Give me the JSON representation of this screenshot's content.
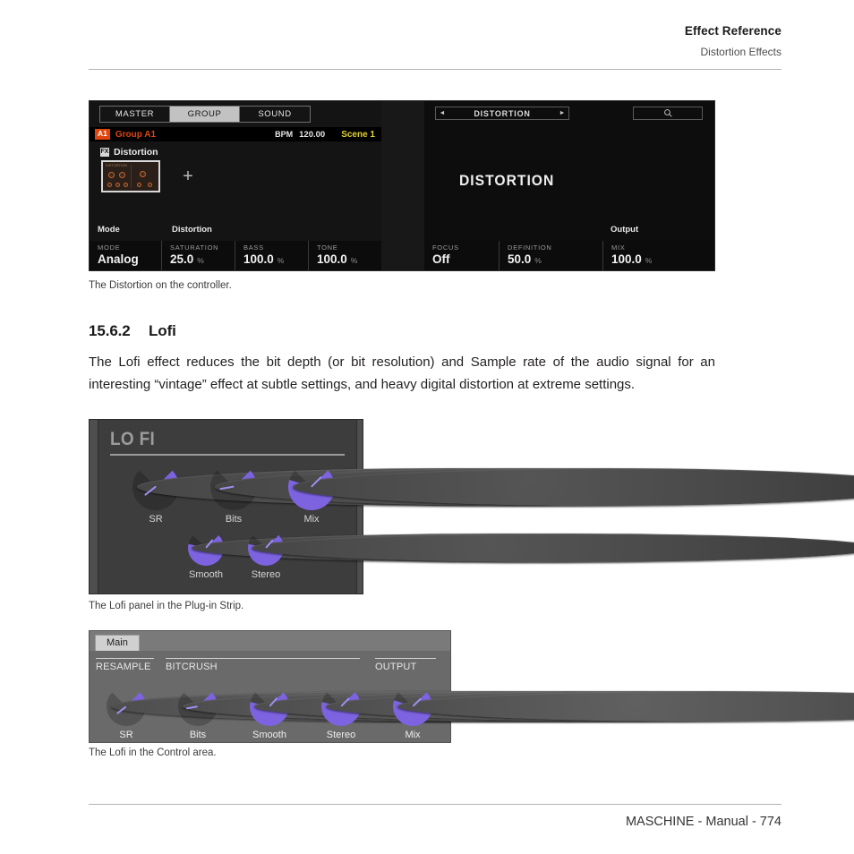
{
  "runhead": {
    "title": "Effect Reference",
    "subtitle": "Distortion Effects"
  },
  "controller_figure": {
    "tabs": [
      {
        "label": "MASTER",
        "selected": false
      },
      {
        "label": "GROUP",
        "selected": true
      },
      {
        "label": "SOUND",
        "selected": false
      }
    ],
    "group_bar": {
      "badge": "A1",
      "name": "Group A1",
      "bpm_label": "BPM",
      "bpm_value": "120.00",
      "scene": "Scene 1"
    },
    "slot": {
      "icon_label": "FX",
      "name": "Distortion",
      "thumbnail_title": "DISTORTION",
      "add_label": "+"
    },
    "left_params": {
      "header_left": "Mode",
      "header_right": "Distortion",
      "cells": [
        {
          "name": "MODE",
          "value": "Analog",
          "unit": ""
        },
        {
          "name": "SATURATION",
          "value": "25.0",
          "unit": "%"
        },
        {
          "name": "BASS",
          "value": "100.0",
          "unit": "%"
        },
        {
          "name": "TONE",
          "value": "100.0",
          "unit": "%"
        }
      ]
    },
    "right_panel": {
      "nav_prev": "◄",
      "nav_title": "DISTORTION",
      "nav_next": "►",
      "search_icon": "search-icon",
      "big_title": "DISTORTION",
      "header_right": "Output",
      "cells": [
        {
          "name": "FOCUS",
          "value": "Off",
          "unit": ""
        },
        {
          "name": "DEFINITION",
          "value": "50.0",
          "unit": "%"
        },
        {
          "name": "MIX",
          "value": "100.0",
          "unit": "%"
        }
      ]
    },
    "caption": "The Distortion on the controller."
  },
  "section": {
    "number": "15.6.2",
    "title": "Lofi",
    "paragraph": "The Lofi effect reduces the bit depth (or bit resolution) and Sample rate of the audio signal for an interesting “vintage” effect at subtle settings, and heavy digital distortion at extreme settings."
  },
  "strip_figure": {
    "title": "LO FI",
    "knobs": [
      {
        "label": "SR",
        "value_deg": -128,
        "arc_pct": 9
      },
      {
        "label": "Bits",
        "value_deg": -100,
        "arc_pct": 16
      },
      {
        "label": "Mix",
        "value_deg": 45,
        "arc_pct": 90
      },
      {
        "label": "Smooth",
        "value_deg": 40,
        "arc_pct": 88
      },
      {
        "label": "Stereo",
        "value_deg": 42,
        "arc_pct": 88
      }
    ],
    "caption": "The Lofi panel in the Plug-in Strip."
  },
  "control_area_figure": {
    "tab": "Main",
    "sections": [
      {
        "label": "RESAMPLE"
      },
      {
        "label": "BITCRUSH"
      },
      {
        "label": "OUTPUT"
      }
    ],
    "knobs": [
      {
        "label": "SR",
        "value_deg": -128,
        "arc_pct": 9
      },
      {
        "label": "Bits",
        "value_deg": -100,
        "arc_pct": 16
      },
      {
        "label": "Smooth",
        "value_deg": 42,
        "arc_pct": 88
      },
      {
        "label": "Stereo",
        "value_deg": 44,
        "arc_pct": 88
      },
      {
        "label": "Mix",
        "value_deg": 46,
        "arc_pct": 90
      }
    ],
    "caption": "The Lofi in the Control area."
  },
  "footer": {
    "text": "MASCHINE - Manual - 774"
  },
  "colors": {
    "accent_purple": "#7d63e0",
    "pointer_purple": "#9d8ff0",
    "group_orange": "#e0450e",
    "scene_yellow": "#ded234",
    "panel_dark": "#3d3d3d",
    "control_gray": "#6a6a6a"
  }
}
